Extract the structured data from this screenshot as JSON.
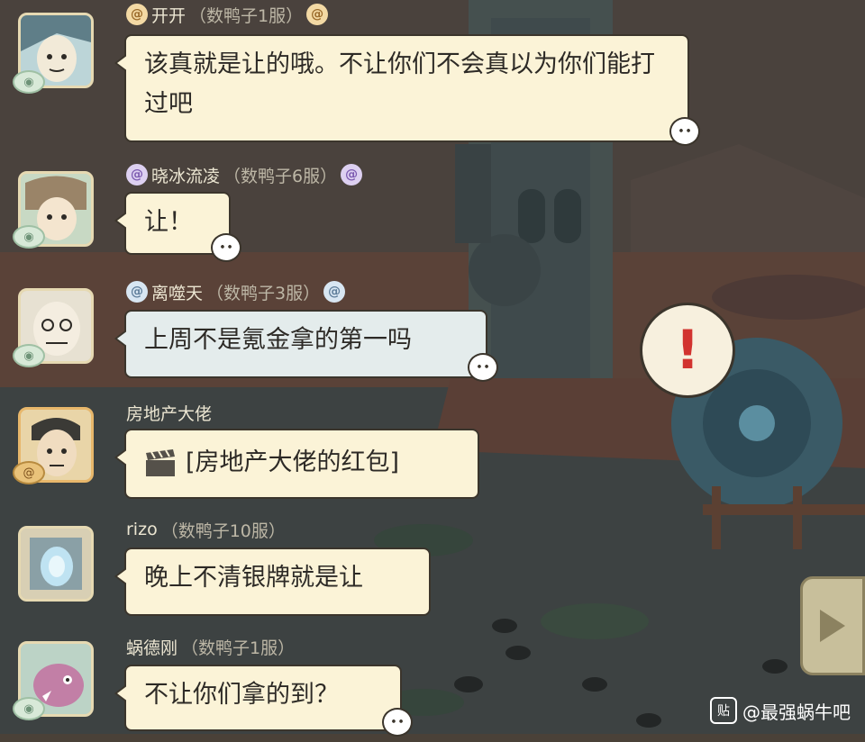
{
  "messages": [
    {
      "name": "开开",
      "server": "（数鸭子1服）",
      "text": "该真就是让的哦。不让你们不会真以为你们能打过吧"
    },
    {
      "name": "晓冰流凌",
      "server": "（数鸭子6服）",
      "text": "让！"
    },
    {
      "name": "离噬天",
      "server": "（数鸭子3服）",
      "text": "上周不是氪金拿的第一吗"
    },
    {
      "name": "房地产大佬",
      "server": "",
      "text": "[房地产大佬的红包]"
    },
    {
      "name": "rizo",
      "server": "（数鸭子10服）",
      "text": "晚上不清银牌就是让"
    },
    {
      "name": "蜗德刚",
      "server": "（数鸭子1服）",
      "text": "不让你们拿的到？"
    }
  ],
  "alert_symbol": "!",
  "watermark": {
    "logo": "贴",
    "text": "@最强蜗牛吧"
  },
  "icons": {
    "avatar_badge": "eye-icon",
    "snail_badge": "snail-icon",
    "red_packet": "clapperboard-icon",
    "play": "play-icon"
  },
  "colors": {
    "bubble": "#fbf3d7",
    "bubble_blue": "#e4ecec",
    "alert": "#d2332f",
    "name_text": "#ece6d2"
  }
}
